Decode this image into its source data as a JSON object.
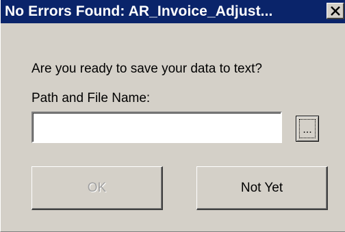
{
  "window": {
    "title": "No Errors Found: AR_Invoice_Adjust...",
    "close_icon": "close-icon"
  },
  "dialog": {
    "prompt": "Are you ready to save your data to text?",
    "path_label": "Path and File Name:",
    "path_value": "",
    "browse_label": "...",
    "ok_label": "OK",
    "ok_enabled": false,
    "not_yet_label": "Not Yet"
  },
  "colors": {
    "titlebar": "#0a246a",
    "dialog_bg": "#d4d0c8",
    "disabled_text": "#a0a0a0"
  }
}
